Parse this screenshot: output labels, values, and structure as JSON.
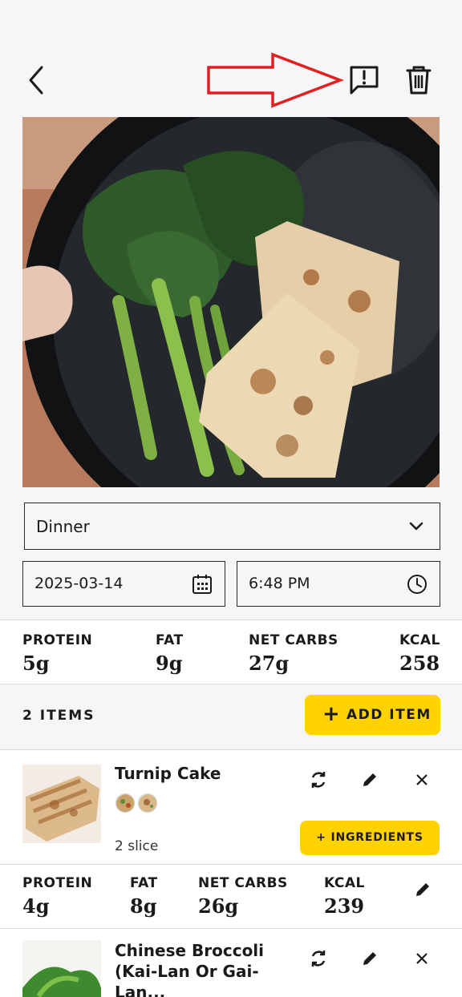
{
  "header": {
    "back_icon": "chevron-left-icon",
    "report_icon": "report-issue-icon",
    "delete_icon": "trash-icon",
    "annotation_arrow_color": "#e02020"
  },
  "meal": {
    "type": "Dinner",
    "date": "2025-03-14",
    "time": "6:48 PM"
  },
  "totals": {
    "protein_label": "PROTEIN",
    "protein": "5g",
    "fat_label": "FAT",
    "fat": "9g",
    "carbs_label": "NET CARBS",
    "carbs": "27g",
    "kcal_label": "KCAL",
    "kcal": "258"
  },
  "items_header": {
    "count": "2 ITEMS",
    "add_label": "ADD ITEM"
  },
  "items": [
    {
      "name": "Turnip Cake",
      "serving": "2 slice",
      "ingredients_label": "+ INGREDIENTS",
      "protein_label": "PROTEIN",
      "protein": "4g",
      "fat_label": "FAT",
      "fat": "8g",
      "carbs_label": "NET CARBS",
      "carbs": "26g",
      "kcal_label": "KCAL",
      "kcal": "239"
    },
    {
      "name": "Chinese Broccoli (Kai-Lan Or Gai-Lan..."
    }
  ],
  "colors": {
    "accent": "#ffd200",
    "text": "#1a1a1a",
    "background": "#f6f6f8"
  }
}
